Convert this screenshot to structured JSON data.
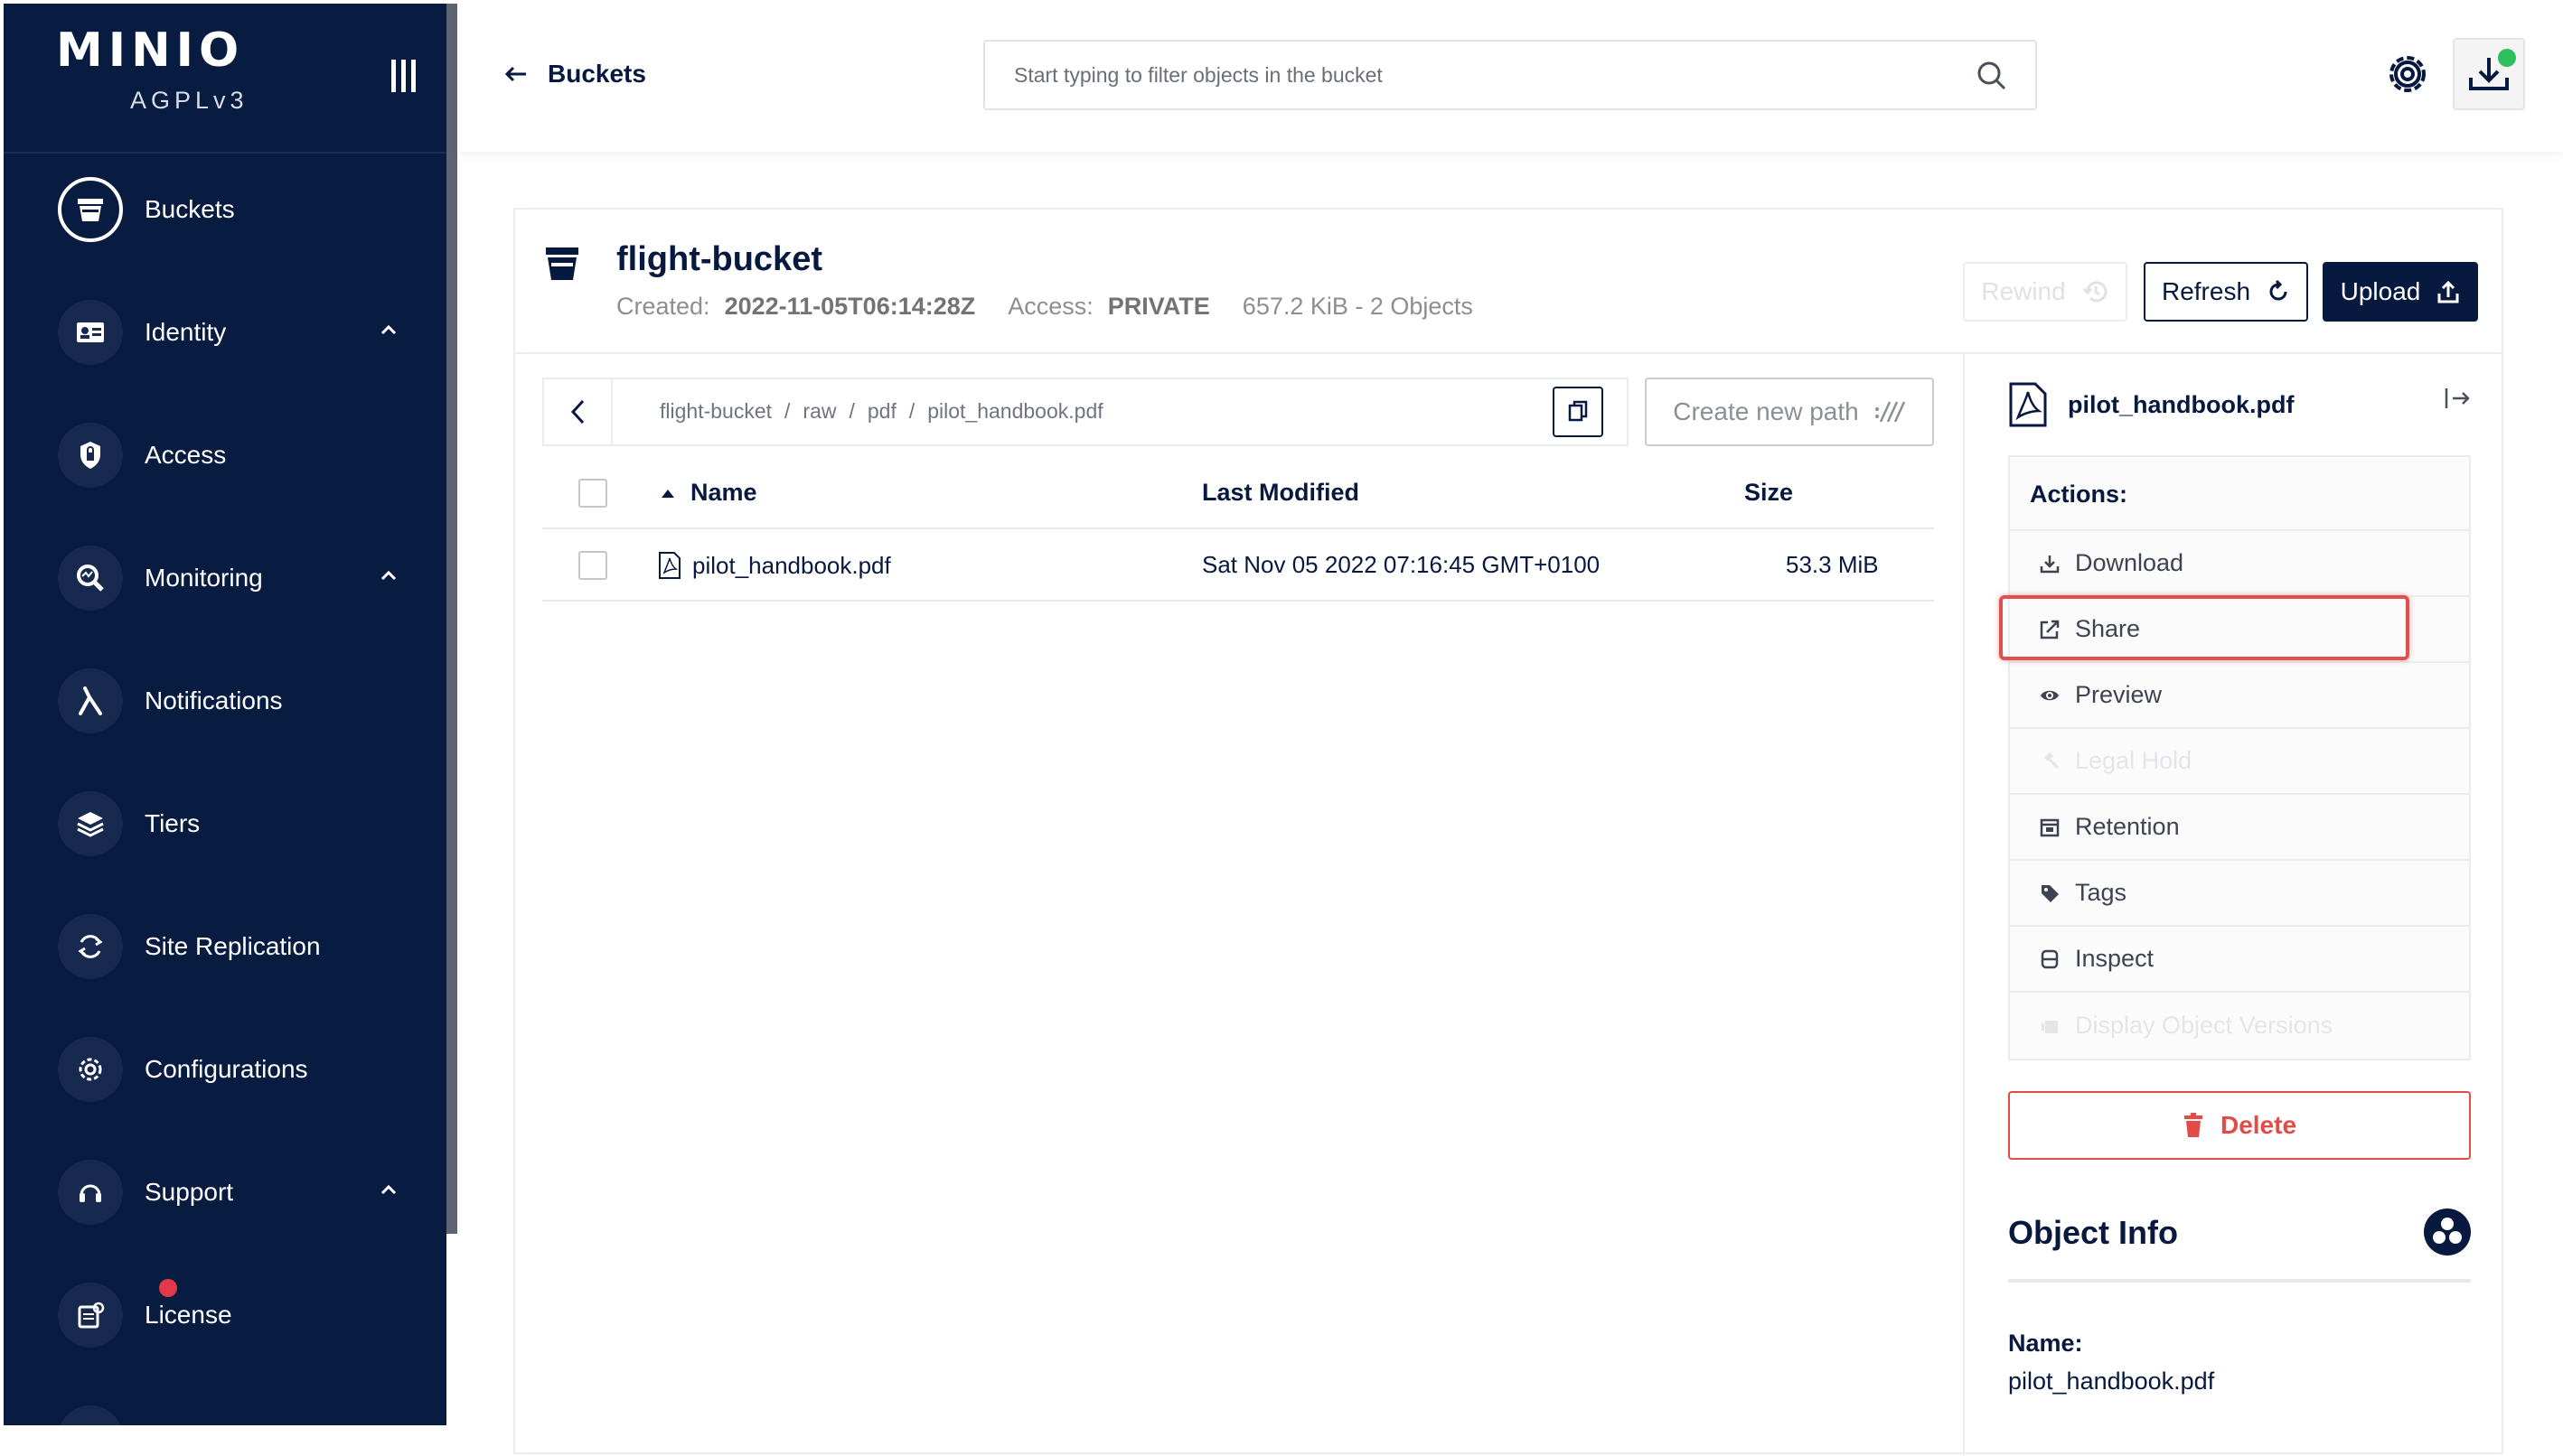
{
  "sidebar": {
    "logo": "MINIO",
    "license": "AGPLv3",
    "items": [
      {
        "label": "Buckets",
        "icon": "bucket-icon",
        "active": true
      },
      {
        "label": "Identity",
        "icon": "identity-icon",
        "expandable": true
      },
      {
        "label": "Access",
        "icon": "access-icon"
      },
      {
        "label": "Monitoring",
        "icon": "monitoring-icon",
        "expandable": true
      },
      {
        "label": "Notifications",
        "icon": "lambda-icon"
      },
      {
        "label": "Tiers",
        "icon": "tiers-icon"
      },
      {
        "label": "Site Replication",
        "icon": "site-replication-icon"
      },
      {
        "label": "Configurations",
        "icon": "configurations-icon"
      },
      {
        "label": "Support",
        "icon": "support-icon",
        "expandable": true
      },
      {
        "label": "License",
        "icon": "license-icon",
        "badge": true
      }
    ]
  },
  "topbar": {
    "back_label": "Buckets",
    "search_placeholder": "Start typing to filter objects in the bucket"
  },
  "bucket": {
    "name": "flight-bucket",
    "created_label": "Created:",
    "created_value": "2022-11-05T06:14:28Z",
    "access_label": "Access:",
    "access_value": "PRIVATE",
    "summary": "657.2 KiB - 2 Objects"
  },
  "buttons": {
    "rewind": "Rewind",
    "refresh": "Refresh",
    "upload": "Upload",
    "create_new_path": "Create new path"
  },
  "breadcrumb": [
    "flight-bucket",
    "raw",
    "pdf",
    "pilot_handbook.pdf"
  ],
  "table": {
    "columns": [
      "Name",
      "Last Modified",
      "Size"
    ],
    "rows": [
      {
        "name": "pilot_handbook.pdf",
        "modified": "Sat Nov 05 2022 07:16:45 GMT+0100",
        "size": "53.3 MiB"
      }
    ]
  },
  "details": {
    "file_name": "pilot_handbook.pdf",
    "actions_title": "Actions:",
    "actions": [
      {
        "label": "Download",
        "icon": "download-icon",
        "enabled": true
      },
      {
        "label": "Share",
        "icon": "share-icon",
        "enabled": true,
        "highlighted": true
      },
      {
        "label": "Preview",
        "icon": "eye-icon",
        "enabled": true
      },
      {
        "label": "Legal Hold",
        "icon": "gavel-icon",
        "enabled": false
      },
      {
        "label": "Retention",
        "icon": "retention-icon",
        "enabled": true
      },
      {
        "label": "Tags",
        "icon": "tag-icon",
        "enabled": true
      },
      {
        "label": "Inspect",
        "icon": "inspect-icon",
        "enabled": true
      },
      {
        "label": "Display Object Versions",
        "icon": "versions-icon",
        "enabled": false
      }
    ],
    "delete_label": "Delete",
    "object_info_title": "Object Info",
    "info_name_label": "Name:",
    "info_name_value": "pilot_handbook.pdf"
  },
  "colors": {
    "sidebar_bg": "#081c42",
    "primary": "#07193e",
    "danger": "#e34b47",
    "highlight": "#e0514e",
    "status_green": "#2cbf5b"
  }
}
